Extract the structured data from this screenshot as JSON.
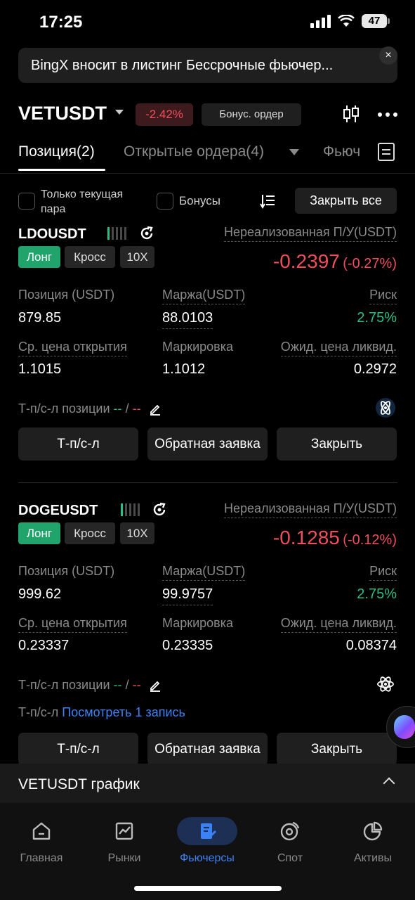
{
  "status_bar": {
    "time": "17:25",
    "battery": "47"
  },
  "banner": {
    "text": "BingX вносит в листинг Бессрочные фьючер...",
    "close": "×"
  },
  "header": {
    "symbol": "VETUSDT",
    "change": "-2.42%",
    "bonus_order": "Бонус. ордер"
  },
  "tabs": {
    "positions": "Позиция(2)",
    "open_orders": "Открытые ордера(4)",
    "futures": "Фьюч"
  },
  "filters": {
    "current_pair": "Только текущая пара",
    "bonuses": "Бонусы",
    "close_all": "Закрыть все"
  },
  "positions": [
    {
      "pair": "LDOUSDT",
      "tags": {
        "side": "Лонг",
        "margin_mode": "Кросс",
        "leverage": "10X"
      },
      "pnl_label": "Нереализованная П/У(USDT)",
      "pnl": "-0.2397",
      "pnl_pct": "(-0.27%)",
      "position_label": "Позиция (USDT)",
      "position": "879.85",
      "margin_label": "Маржа(USDT)",
      "margin": "88.0103",
      "risk_label": "Риск",
      "risk": "2.75%",
      "entry_label": "Ср. цена открытия",
      "entry": "1.1015",
      "mark_label": "Маркировка",
      "mark": "1.1012",
      "liq_label": "Ожид. цена ликвид.",
      "liq": "0.2972",
      "tpsl_label": "Т-п/с-л позиции",
      "tp": "--",
      "sep": "/",
      "sl": "--",
      "buttons": {
        "tpsl": "Т-п/с-л",
        "reverse": "Обратная заявка",
        "close": "Закрыть"
      }
    },
    {
      "pair": "DOGEUSDT",
      "tags": {
        "side": "Лонг",
        "margin_mode": "Кросс",
        "leverage": "10X"
      },
      "pnl_label": "Нереализованная П/У(USDT)",
      "pnl": "-0.1285",
      "pnl_pct": "(-0.12%)",
      "position_label": "Позиция (USDT)",
      "position": "999.62",
      "margin_label": "Маржа(USDT)",
      "margin": "99.9757",
      "risk_label": "Риск",
      "risk": "2.75%",
      "entry_label": "Ср. цена открытия",
      "entry": "0.23337",
      "mark_label": "Маркировка",
      "mark": "0.23335",
      "liq_label": "Ожид. цена ликвид.",
      "liq": "0.08374",
      "tpsl_label": "Т-п/с-л позиции",
      "tp": "--",
      "sep": "/",
      "sl": "--",
      "record_label": "Т-п/с-л",
      "record_link": "Посмотреть 1 запись",
      "buttons": {
        "tpsl": "Т-п/с-л",
        "reverse": "Обратная заявка",
        "close": "Закрыть"
      }
    }
  ],
  "chart_panel": {
    "title": "VETUSDT график"
  },
  "bottom_nav": [
    {
      "label": "Главная",
      "icon": "home-icon"
    },
    {
      "label": "Рынки",
      "icon": "markets-icon"
    },
    {
      "label": "Фьючерсы",
      "icon": "futures-icon",
      "active": true
    },
    {
      "label": "Спот",
      "icon": "spot-icon"
    },
    {
      "label": "Активы",
      "icon": "assets-icon"
    }
  ],
  "colors": {
    "green": "#2ebd85",
    "red": "#ef4f5d",
    "blue": "#3b82f6"
  }
}
